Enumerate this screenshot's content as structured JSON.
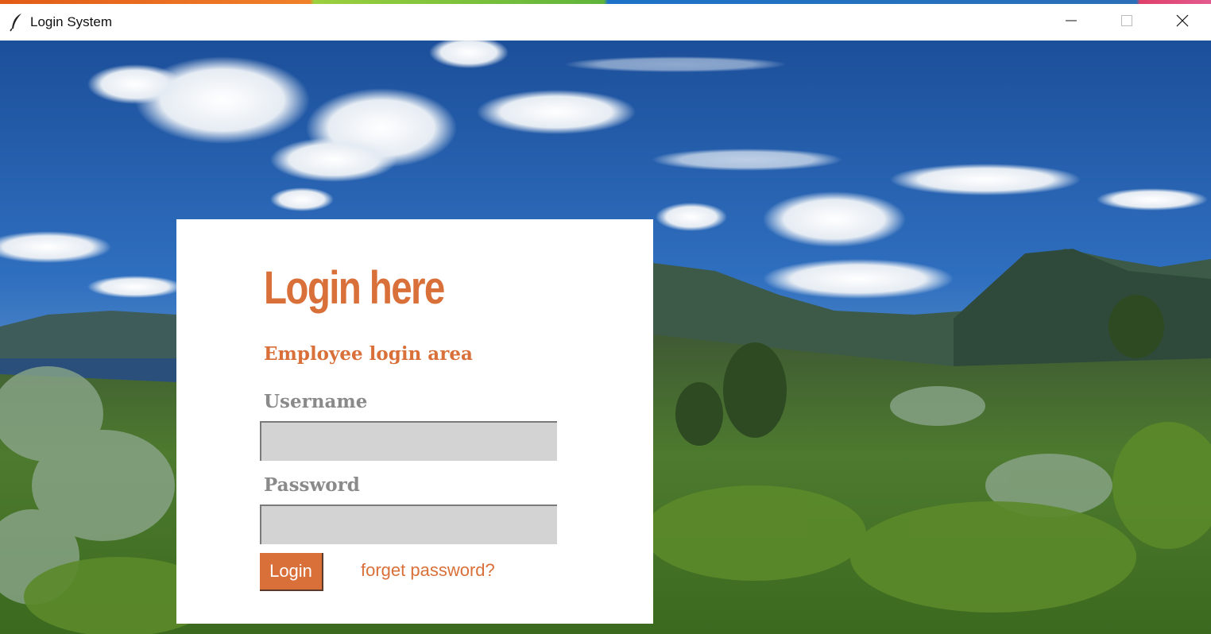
{
  "window": {
    "title": "Login System",
    "icon": "feather-icon",
    "controls": {
      "minimize": "minimize-icon",
      "maximize": "maximize-icon",
      "close": "close-icon"
    }
  },
  "background": {
    "description_icon": "landscape-image"
  },
  "login": {
    "title": "Login here",
    "subtitle": "Employee login area",
    "username_label": "Username",
    "username_value": "",
    "password_label": "Password",
    "password_value": "",
    "login_button": "Login",
    "forget_link": "forget password?"
  },
  "colors": {
    "accent": "#d9703a",
    "label_gray": "#8a8a8a",
    "input_bg": "#d3d3d3",
    "panel_bg": "#ffffff"
  }
}
